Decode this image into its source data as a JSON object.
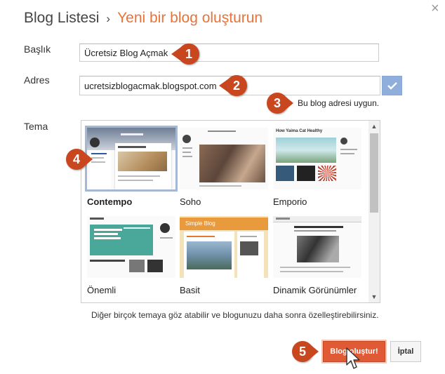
{
  "dialog": {
    "breadcrumb_parent": "Blog Listesi",
    "breadcrumb_separator": "›",
    "breadcrumb_current": "Yeni bir blog oluşturun",
    "close_icon": "×"
  },
  "form": {
    "title_label": "Başlık",
    "title_value": "Ücretsiz Blog Açmak",
    "address_label": "Adres",
    "address_value": "ucretsizblogacmak.blogspot.com",
    "address_status": "Bu blog adresi uygun.",
    "theme_label": "Tema"
  },
  "themes": [
    {
      "name": "Contempo",
      "selected": true
    },
    {
      "name": "Soho",
      "selected": false
    },
    {
      "name": "Emporio",
      "selected": false
    },
    {
      "name": "Önemli",
      "selected": false
    },
    {
      "name": "Basit",
      "selected": false
    },
    {
      "name": "Dinamik Görünümler",
      "selected": false
    }
  ],
  "thumb_text": {
    "emporio_title": "How Yaima Cat Healthy",
    "basit_title": "Simple Blog"
  },
  "hint": "Diğer birçok temaya göz atabilir ve blogunuzu daha sonra özelleştirebilirsiniz.",
  "buttons": {
    "create": "Blog oluştur!",
    "cancel": "İptal"
  },
  "callouts": [
    "1",
    "2",
    "3",
    "4",
    "5"
  ],
  "colors": {
    "accent": "#e8733a",
    "callout": "#c9471f",
    "primary_button": "#e05a35",
    "check_button": "#8faedb"
  }
}
